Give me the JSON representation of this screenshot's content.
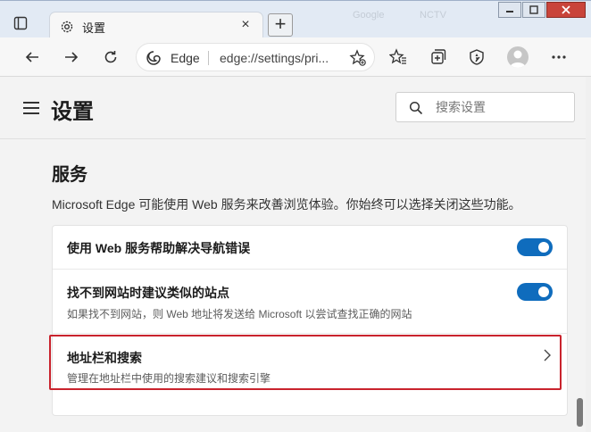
{
  "browser": {
    "tab_title": "设置",
    "tab_close": "×",
    "new_tab": "+",
    "address_label": "Edge",
    "address_url": "edge://settings/pri...",
    "ghost_tab_1": "Google",
    "ghost_tab_2": "NCTV"
  },
  "settings": {
    "title": "设置",
    "search_placeholder": "搜索设置",
    "section_title": "服务",
    "section_desc": "Microsoft Edge 可能使用 Web 服务来改善浏览体验。你始终可以选择关闭这些功能。",
    "items": [
      {
        "title": "使用 Web 服务帮助解决导航错误",
        "subtitle": "",
        "control": "toggle",
        "enabled": true
      },
      {
        "title": "找不到网站时建议类似的站点",
        "subtitle": "如果找不到网站，则 Web 地址将发送给 Microsoft 以尝试查找正确的网站",
        "control": "toggle",
        "enabled": true
      },
      {
        "title": "地址栏和搜索",
        "subtitle": "管理在地址栏中使用的搜索建议和搜索引擎",
        "control": "chevron"
      }
    ]
  },
  "colors": {
    "accent": "#0f6cbd",
    "highlight": "#c9232d"
  }
}
